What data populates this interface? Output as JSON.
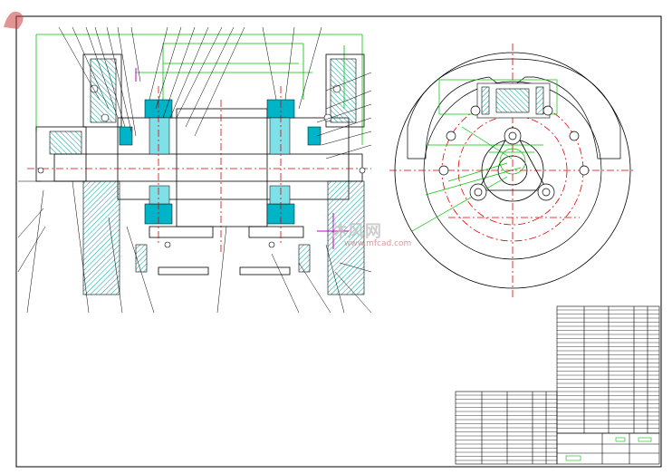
{
  "watermark": {
    "brand": "沐风网",
    "url": "www.mfcad.com"
  },
  "colors": {
    "outline": "#000000",
    "dimension": "#00c000",
    "center_line": "#e00000",
    "section_fill": "#00b4c8",
    "hatch": "#00a0a0",
    "accent_magenta": "#c000c0",
    "paper": "#ffffff"
  },
  "drawing": {
    "views": [
      "section-view",
      "end-view"
    ],
    "tables": [
      "parts-list-upper",
      "parts-list-lower",
      "title-block"
    ]
  }
}
